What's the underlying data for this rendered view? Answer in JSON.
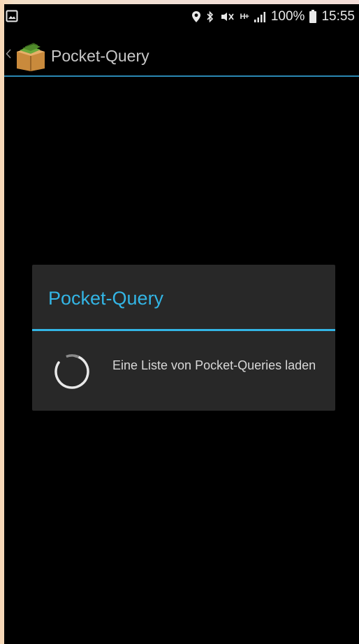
{
  "status_bar": {
    "battery": "100%",
    "time": "15:55",
    "network_type": "H+",
    "icons": [
      "gallery-icon",
      "location-icon",
      "bluetooth-icon",
      "mute-icon",
      "signal-icon",
      "battery-icon"
    ]
  },
  "action_bar": {
    "title": "Pocket-Query",
    "icons": [
      "back-icon",
      "app-icon"
    ]
  },
  "dialog": {
    "title": "Pocket-Query",
    "message": "Eine Liste von Pocket-Queries laden",
    "icons": [
      "progress-spinner-icon"
    ]
  },
  "colors": {
    "accent": "#33b5e5",
    "dialog_bg": "#282828",
    "background": "#000000"
  }
}
